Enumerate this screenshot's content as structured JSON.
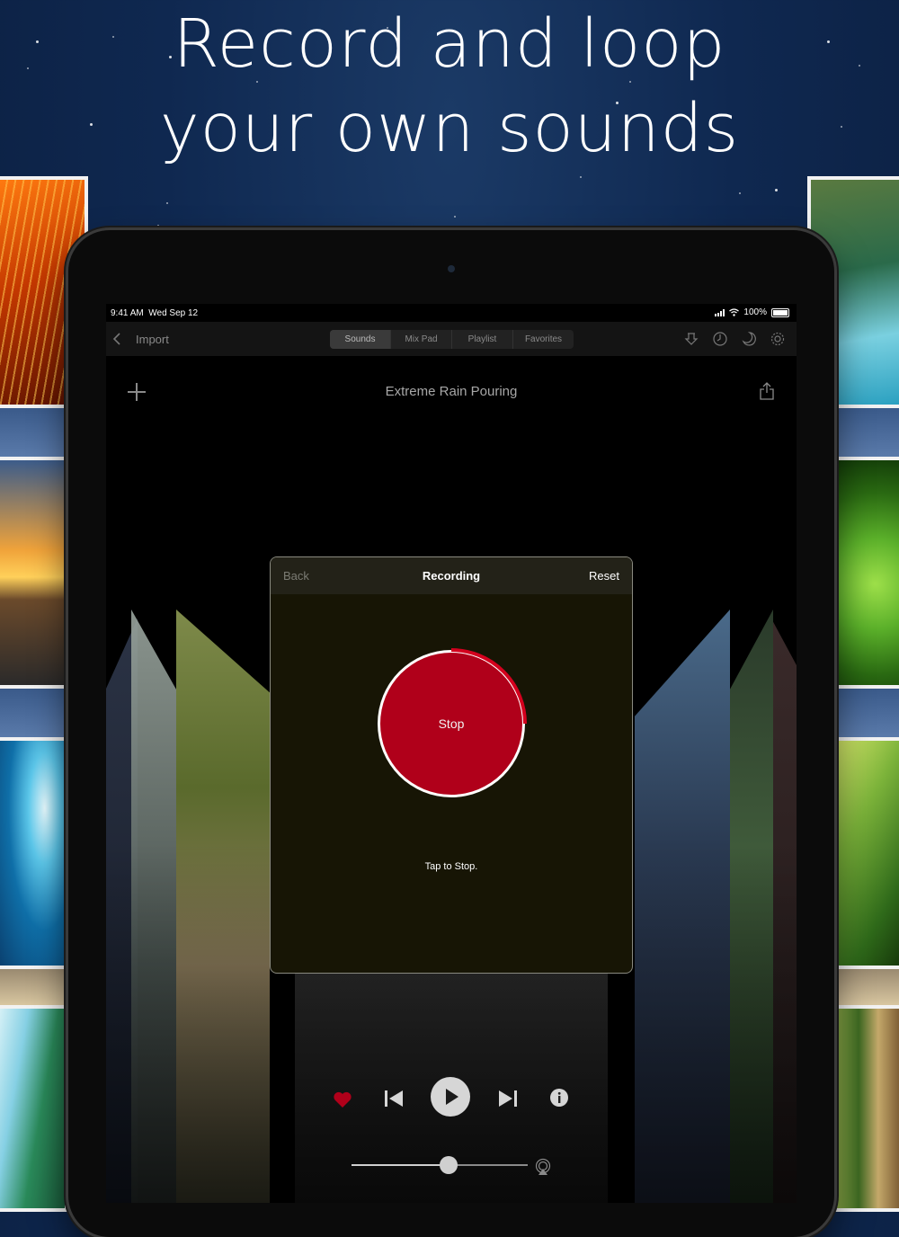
{
  "headline": {
    "line1": "Record and loop",
    "line2": "your own sounds"
  },
  "status_bar": {
    "time": "9:41 AM",
    "date": "Wed Sep 12",
    "battery": "100%"
  },
  "nav": {
    "import_label": "Import",
    "tabs": [
      {
        "label": "Sounds",
        "active": true
      },
      {
        "label": "Mix Pad",
        "active": false
      },
      {
        "label": "Playlist",
        "active": false
      },
      {
        "label": "Favorites",
        "active": false
      }
    ],
    "icons": [
      "download-icon",
      "timer-icon",
      "moon-icon",
      "gear-icon"
    ]
  },
  "sound": {
    "title": "Extreme Rain Pouring"
  },
  "recording_dialog": {
    "back_label": "Back",
    "title": "Recording",
    "reset_label": "Reset",
    "button_label": "Stop",
    "hint": "Tap to Stop.",
    "progress": 0.25,
    "accent": "#b0001a"
  },
  "player": {
    "favorite_color": "#b0001a",
    "volume": 0.55
  }
}
